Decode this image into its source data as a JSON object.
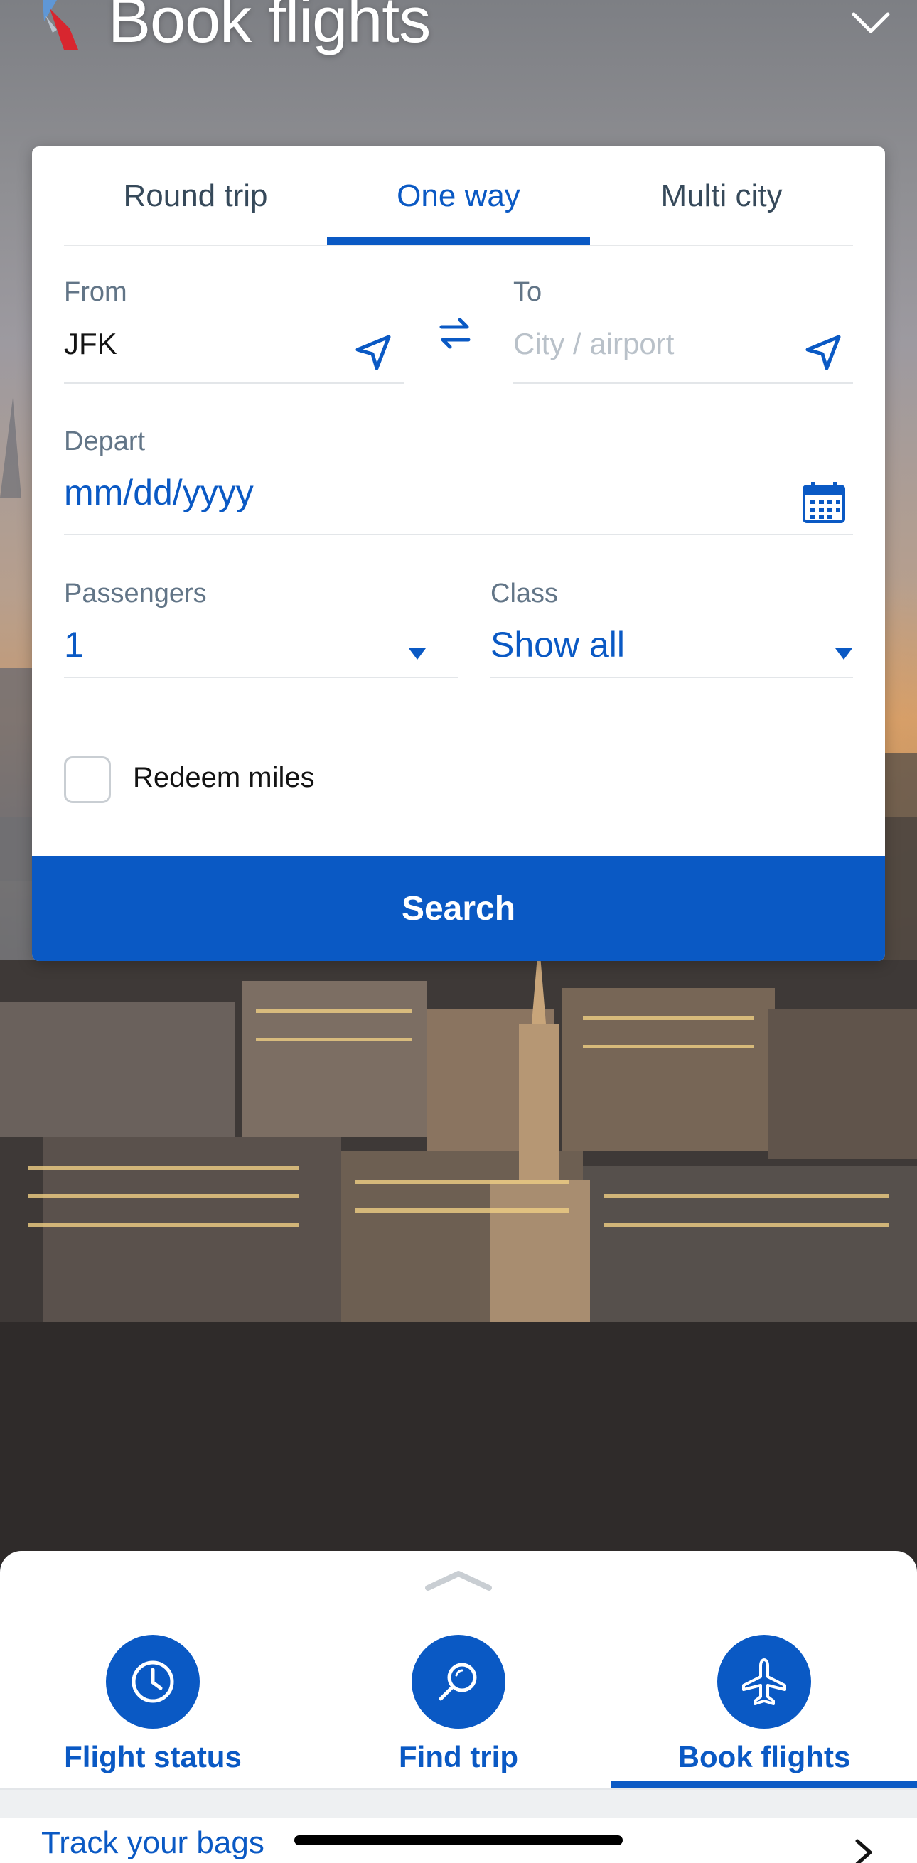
{
  "header": {
    "title": "Book flights"
  },
  "trip_tabs": [
    {
      "label": "Round trip"
    },
    {
      "label": "One way",
      "active": true
    },
    {
      "label": "Multi city"
    }
  ],
  "from": {
    "label": "From",
    "value": "JFK"
  },
  "to": {
    "label": "To",
    "placeholder": "City / airport"
  },
  "depart": {
    "label": "Depart",
    "placeholder": "mm/dd/yyyy"
  },
  "passengers": {
    "label": "Passengers",
    "value": "1"
  },
  "class": {
    "label": "Class",
    "value": "Show all"
  },
  "redeem": {
    "label": "Redeem miles",
    "checked": false
  },
  "search_button": {
    "label": "Search"
  },
  "bottom_nav": [
    {
      "label": "Flight status",
      "icon": "clock-icon"
    },
    {
      "label": "Find trip",
      "icon": "magnifier-icon"
    },
    {
      "label": "Book flights",
      "icon": "airplane-icon",
      "active": true
    }
  ],
  "track_bags": {
    "label": "Track your bags"
  },
  "colors": {
    "accent": "#0a59c4",
    "text": "#131313",
    "muted": "#627587",
    "divider": "#e3e6e9"
  }
}
